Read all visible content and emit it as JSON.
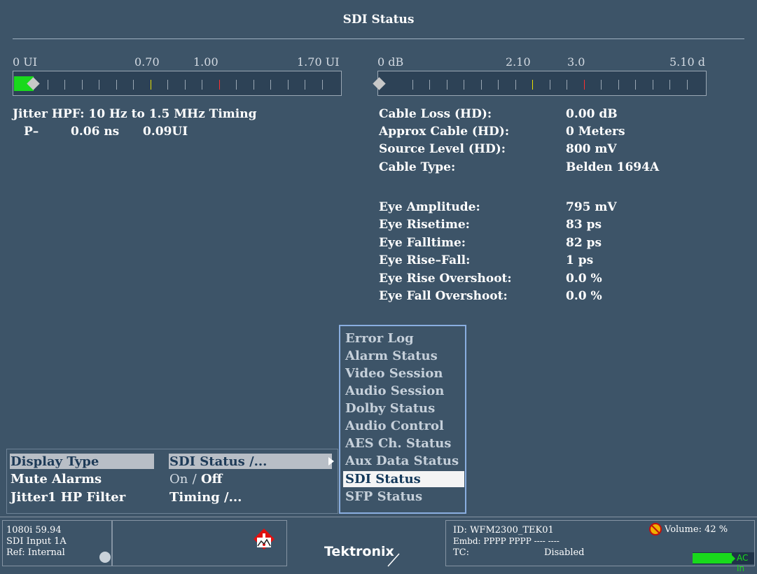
{
  "title": "SDI Status",
  "jitter_meter": {
    "labels": [
      "0 UI",
      "0.70",
      "1.00",
      "1.70 UI"
    ],
    "value_ui": 0.06
  },
  "cable_meter": {
    "labels": [
      "0 dB",
      "2.10",
      "3.0",
      "5.10 d"
    ],
    "value_db": 0.0
  },
  "jitter": {
    "heading": "Jitter HPF: 10 Hz to 1.5 MHz Timing",
    "p_label": "P–",
    "ns": "0.06 ns",
    "ui": "0.09UI"
  },
  "cable_info": [
    {
      "label": "Cable Loss (HD):",
      "value": "0.00 dB"
    },
    {
      "label": "Approx Cable (HD):",
      "value": "0 Meters"
    },
    {
      "label": "Source Level (HD):",
      "value": "800 mV"
    },
    {
      "label": "Cable Type:",
      "value": "Belden 1694A"
    }
  ],
  "eye_info": [
    {
      "label": "Eye Amplitude:",
      "value": "795 mV"
    },
    {
      "label": "Eye Risetime:",
      "value": "83 ps"
    },
    {
      "label": "Eye Falltime:",
      "value": "82 ps"
    },
    {
      "label": "Eye Rise–Fall:",
      "value": "1 ps"
    },
    {
      "label": "Eye Rise Overshoot:",
      "value": "0.0 %"
    },
    {
      "label": "Eye Fall Overshoot:",
      "value": "0.0 %"
    }
  ],
  "popup_menu": {
    "items": [
      "Error Log",
      "Alarm Status",
      "Video Session",
      "Audio Session",
      "Dolby Status",
      "Audio Control",
      "AES Ch. Status",
      "Aux Data Status",
      "SDI Status",
      "SFP Status"
    ],
    "selected": "SDI Status"
  },
  "bottom_menu": {
    "display_type_label": "Display Type",
    "display_type_value": "SDI Status /...",
    "mute_alarms_label": "Mute Alarms",
    "mute_on": "On",
    "mute_sep": "/",
    "mute_off": "Off",
    "jitter_filter_label": "Jitter1 HP Filter",
    "jitter_filter_value": "Timing /..."
  },
  "status_bar": {
    "format": "1080i 59.94",
    "input": "SDI Input 1A",
    "ref": "Ref: Internal",
    "brand": "Tektronix",
    "id": "ID: WFM2300_TEK01",
    "embd": "Embd: PPPP PPPP ---- ----",
    "tc_label": "TC:",
    "tc_value": "Disabled",
    "volume": "Volume:  42 %",
    "ac_in": "AC In"
  },
  "colors": {
    "background": "#3d5468",
    "meter_green": "#19d91c",
    "tick_yellow": "#e8e000",
    "tick_red": "#ff3030",
    "popup_border": "#8aaee0"
  }
}
